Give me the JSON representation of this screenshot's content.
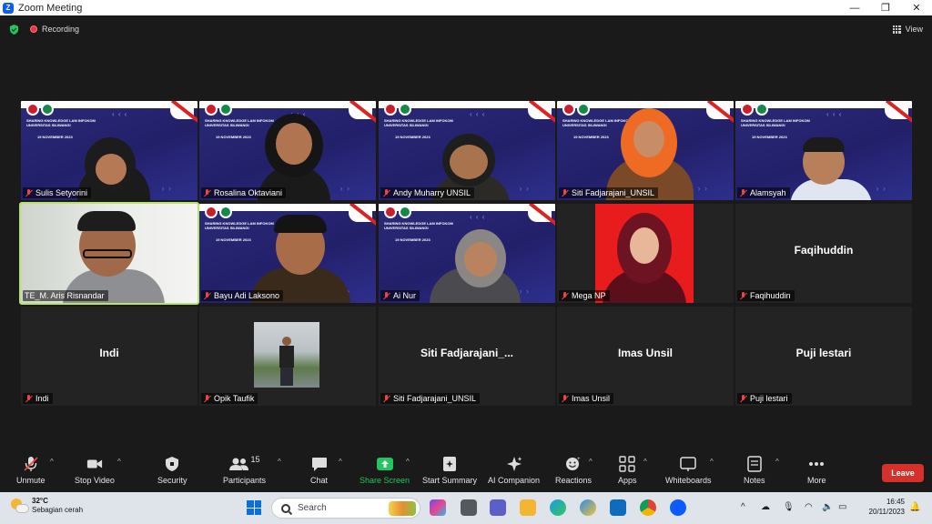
{
  "window": {
    "title": "Zoom Meeting",
    "minimize": "—",
    "maximize": "❐",
    "close": "✕"
  },
  "topbar": {
    "recording": "Recording",
    "view": "View"
  },
  "slide": {
    "title_line1": "SHARING KNOWLEDGE LAM INFOKOM",
    "title_line2": "UNIVERSITAS SILIWANGI",
    "date": "19 NOVEMBER 2023",
    "chevrons": "‹ ‹ ‹",
    "chevrons2": "› ›"
  },
  "tiles": [
    {
      "name": "Sulis Setyorini"
    },
    {
      "name": "Rosalina Oktaviani"
    },
    {
      "name": "Andy Muharry UNSIL"
    },
    {
      "name": "Siti Fadjarajani_UNSIL"
    },
    {
      "name": "Alamsyah"
    },
    {
      "name": "TE_M. Aris Risnandar"
    },
    {
      "name": "Bayu Adi Laksono"
    },
    {
      "name": "Ai Nur"
    },
    {
      "name": "Mega NP"
    },
    {
      "name": "Faqihuddin",
      "display": "Faqihuddin"
    },
    {
      "name": "Indi",
      "display": "Indi"
    },
    {
      "name": "Opik Taufik"
    },
    {
      "name": "Siti Fadjarajani_UNSIL",
      "display": "Siti  Fadjarajani_..."
    },
    {
      "name": "Imas Unsil",
      "display": "Imas Unsil"
    },
    {
      "name": "Puji lestari",
      "display": "Puji lestari"
    }
  ],
  "toolbar": {
    "unmute": "Unmute",
    "stop_video": "Stop Video",
    "security": "Security",
    "participants": "Participants",
    "participants_count": "15",
    "chat": "Chat",
    "share_screen": "Share Screen",
    "start_summary": "Start Summary",
    "ai_companion": "AI Companion",
    "reactions": "Reactions",
    "apps": "Apps",
    "whiteboards": "Whiteboards",
    "notes": "Notes",
    "more": "More",
    "leave": "Leave",
    "caret": "^"
  },
  "taskbar": {
    "temperature": "32°C",
    "weather": "Sebagian cerah",
    "search_placeholder": "Search",
    "time": "16:45",
    "date": "20/11/2023",
    "tray_caret": "^"
  },
  "colors": {
    "active_speaker": "#b7e36b",
    "leave": "#d6302a",
    "share_screen": "#22c55e",
    "muted": "#e44444"
  }
}
